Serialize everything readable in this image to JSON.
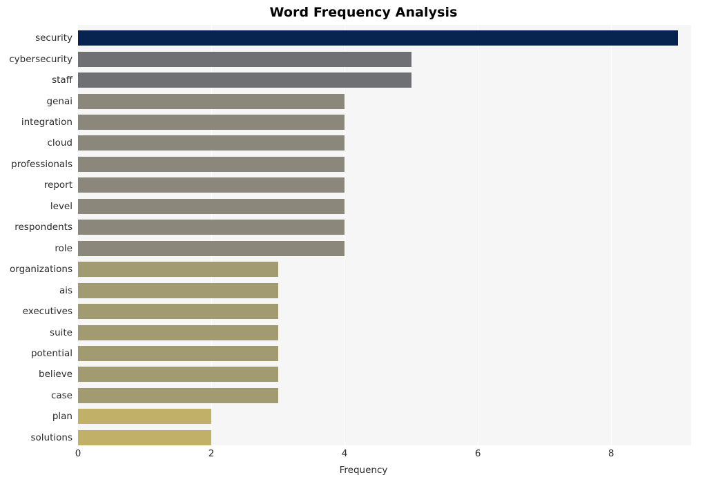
{
  "chart_data": {
    "type": "bar",
    "orientation": "horizontal",
    "title": "Word Frequency Analysis",
    "xlabel": "Frequency",
    "ylabel": "",
    "xlim": [
      0,
      9.2
    ],
    "xticks": [
      0,
      2,
      4,
      6,
      8
    ],
    "xtick_labels": [
      "0",
      "2",
      "4",
      "6",
      "8"
    ],
    "grid": "vertical",
    "legend": "none",
    "categories": [
      "security",
      "cybersecurity",
      "staff",
      "genai",
      "integration",
      "cloud",
      "professionals",
      "report",
      "level",
      "respondents",
      "role",
      "organizations",
      "ais",
      "executives",
      "suite",
      "potential",
      "believe",
      "case",
      "plan",
      "solutions"
    ],
    "values": [
      9,
      5,
      5,
      4,
      4,
      4,
      4,
      4,
      4,
      4,
      4,
      3,
      3,
      3,
      3,
      3,
      3,
      3,
      2,
      2
    ],
    "bar_colors": [
      "#06244f",
      "#6e7073",
      "#6e7073",
      "#8b887b",
      "#8b887b",
      "#8b887b",
      "#8b887b",
      "#8b887b",
      "#8b887b",
      "#8b887b",
      "#8b887b",
      "#a29b72",
      "#a29b72",
      "#a29b72",
      "#a29b72",
      "#a29b72",
      "#a29b72",
      "#a29b72",
      "#c0b068",
      "#c0b068"
    ]
  },
  "colors": {
    "plot_background": "#f6f6f7",
    "page_background": "#ffffff",
    "gridline": "#ffffff",
    "text": "#2b2b2b",
    "title_text": "#000000"
  }
}
